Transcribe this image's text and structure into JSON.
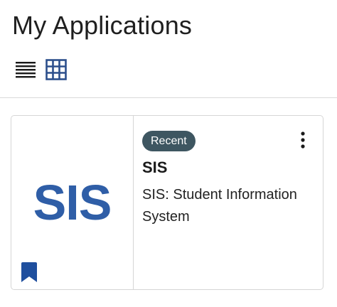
{
  "page": {
    "title": "My Applications"
  },
  "view_toggle": {
    "options": [
      {
        "name": "list-view",
        "icon": "list-icon",
        "selected": false,
        "color": "#1a1a1a"
      },
      {
        "name": "grid-view",
        "icon": "grid-icon",
        "selected": true,
        "color": "#2c4f8c"
      }
    ]
  },
  "applications": [
    {
      "logo_text": "SIS",
      "logo_color": "#2f5ea7",
      "badge": "Recent",
      "badge_color": "#3e5661",
      "name": "SIS",
      "description": "SIS: Student Information System",
      "bookmarked": true,
      "bookmark_color": "#1f4f9e",
      "menu_icon": "more-vertical-icon"
    }
  ]
}
